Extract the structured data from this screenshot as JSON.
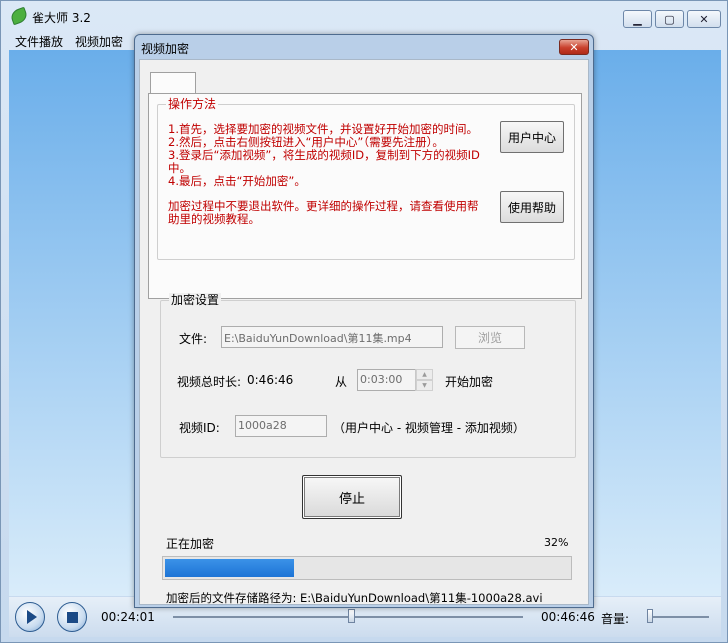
{
  "app": {
    "title": "雀大师 3.2",
    "menu": [
      {
        "label": "文件播放"
      },
      {
        "label": "视频加密"
      }
    ],
    "window_buttons": {
      "minimize": "▁",
      "maximize": "▢",
      "close": "✕"
    }
  },
  "player": {
    "current_time": "00:24:01",
    "total_time": "00:46:46",
    "volume_label": "音量:",
    "progress_fraction": 0.51,
    "volume_fraction": 0.0
  },
  "dialog": {
    "title": "视频加密",
    "close_glyph": "✕",
    "method_group": {
      "legend": "操作方法",
      "steps": [
        "1.首先，选择要加密的视频文件，并设置好开始加密的时间。",
        "2.然后，点击右侧按钮进入“用户中心”（需要先注册）。",
        "3.登录后“添加视频”，将生成的视频ID，复制到下方的视频ID中。",
        "4.最后，点击“开始加密”。"
      ],
      "note": "加密过程中不要退出软件。更详细的操作过程，请查看使用帮助里的视频教程。",
      "user_center_button": "用户中心",
      "help_button": "使用帮助"
    },
    "encrypt_group": {
      "legend": "加密设置",
      "file_label": "文件:",
      "file_value": "E:\\BaiduYunDownload\\第11集.mp4",
      "browse_button": "浏览",
      "duration_label": "视频总时长:",
      "duration_value": "0:46:46",
      "from_label": "从",
      "start_time": "0:03:00",
      "start_suffix": "开始加密",
      "video_id_label": "视频ID:",
      "video_id_value": "1000a28",
      "video_id_hint": "（用户中心 - 视频管理 - 添加视频）"
    },
    "stop_button": "停止",
    "status_text": "正在加密",
    "percent_text": "32%",
    "progress_fraction": 0.32,
    "output_path": "加密后的文件存储路径为: E:\\BaiduYunDownload\\第11集-1000a28.avi"
  },
  "colors": {
    "instruction_red": "#c00000",
    "progress_blue": "#1d74d6"
  }
}
